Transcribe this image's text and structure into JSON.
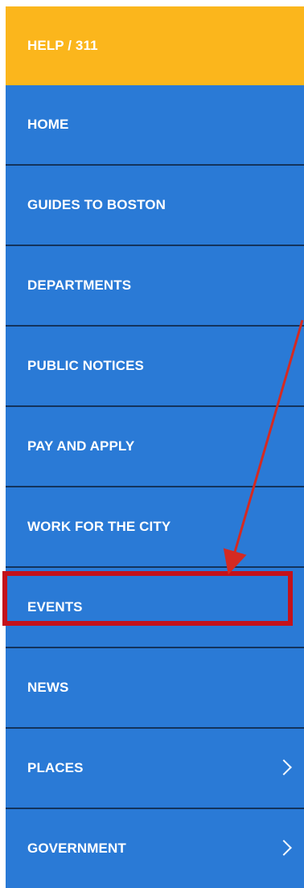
{
  "menu": {
    "items": [
      {
        "label": "HELP / 311",
        "has_submenu": false
      },
      {
        "label": "HOME",
        "has_submenu": false
      },
      {
        "label": "GUIDES TO BOSTON",
        "has_submenu": false
      },
      {
        "label": "DEPARTMENTS",
        "has_submenu": false
      },
      {
        "label": "PUBLIC NOTICES",
        "has_submenu": false
      },
      {
        "label": "PAY AND APPLY",
        "has_submenu": false
      },
      {
        "label": "WORK FOR THE CITY",
        "has_submenu": false
      },
      {
        "label": "EVENTS",
        "has_submenu": false,
        "highlighted": true
      },
      {
        "label": "NEWS",
        "has_submenu": false
      },
      {
        "label": "PLACES",
        "has_submenu": true
      },
      {
        "label": "GOVERNMENT",
        "has_submenu": true
      }
    ]
  },
  "colors": {
    "help_background": "#fbb61c",
    "nav_background": "#2a7ad6",
    "separator": "#13335c",
    "annotation_red": "#c4121b",
    "text": "#ffffff"
  },
  "icons": {
    "submenu": "chevron-right-icon",
    "annotation": "red-arrow-icon"
  }
}
